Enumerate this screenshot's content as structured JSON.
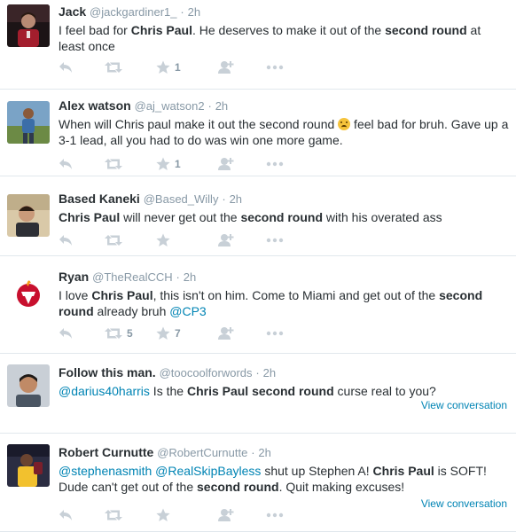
{
  "tweets": [
    {
      "name": "Jack",
      "handle": "@jackgardiner1_",
      "time": "2h",
      "body": [
        {
          "t": "I feel bad for "
        },
        {
          "t": "Chris Paul",
          "b": true
        },
        {
          "t": ". He deserves to make it out of the "
        },
        {
          "t": "second round",
          "b": true
        },
        {
          "t": " at least once"
        }
      ],
      "favorites": "1",
      "retweets": "",
      "view_conversation": ""
    },
    {
      "name": "Alex watson",
      "handle": "@aj_watson2",
      "time": "2h",
      "body": [
        {
          "t": "When will Chris paul make it out the second round "
        },
        {
          "emoji": "crying-face-emoji"
        },
        {
          "t": " feel bad for bruh. Gave up a 3-1 lead, all you had to do was win one more game."
        }
      ],
      "favorites": "1",
      "retweets": "",
      "view_conversation": ""
    },
    {
      "name": "Based Kaneki",
      "handle": "@Based_Willy",
      "time": "2h",
      "body": [
        {
          "t": "Chris Paul",
          "b": true
        },
        {
          "t": " will never get out the "
        },
        {
          "t": "second round",
          "b": true
        },
        {
          "t": " with his overated ass"
        }
      ],
      "favorites": "",
      "retweets": "",
      "view_conversation": ""
    },
    {
      "name": "Ryan",
      "handle": "@TheRealCCH",
      "time": "2h",
      "body": [
        {
          "t": "I love "
        },
        {
          "t": "Chris Paul",
          "b": true
        },
        {
          "t": ", this isn't on him. Come to Miami and get out of the "
        },
        {
          "t": "second round",
          "b": true
        },
        {
          "t": " already bruh "
        },
        {
          "t": "@CP3",
          "link": true
        }
      ],
      "favorites": "7",
      "retweets": "5",
      "view_conversation": ""
    },
    {
      "name": "Follow this man.",
      "handle": "@toocoolforwords",
      "time": "2h",
      "body": [
        {
          "t": "@darius40harris",
          "link": true
        },
        {
          "t": " Is the "
        },
        {
          "t": "Chris Paul second round",
          "b": true
        },
        {
          "t": " curse real to you?"
        }
      ],
      "favorites": "",
      "retweets": "",
      "view_conversation": "View conversation"
    },
    {
      "name": "Robert Curnutte",
      "handle": "@RobertCurnutte",
      "time": "2h",
      "body": [
        {
          "t": "@stephenasmith",
          "link": true
        },
        {
          "t": " "
        },
        {
          "t": "@RealSkipBayless",
          "link": true
        },
        {
          "t": " shut up Stephen A! "
        },
        {
          "t": "Chris Paul",
          "b": true
        },
        {
          "t": " is SOFT! Dude can't get out of the "
        },
        {
          "t": "second round",
          "b": true
        },
        {
          "t": ". Quit making excuses!"
        }
      ],
      "favorites": "",
      "retweets": "",
      "view_conversation": "View conversation"
    }
  ],
  "icons": {
    "reply": "reply-icon",
    "retweet": "retweet-icon",
    "favorite": "star-icon",
    "follow": "follow-icon",
    "more": "more-icon"
  },
  "colors": {
    "action_icon": "#c8d0d7",
    "link": "#0084b4",
    "name": "#292f33",
    "meta": "#8899a6"
  }
}
